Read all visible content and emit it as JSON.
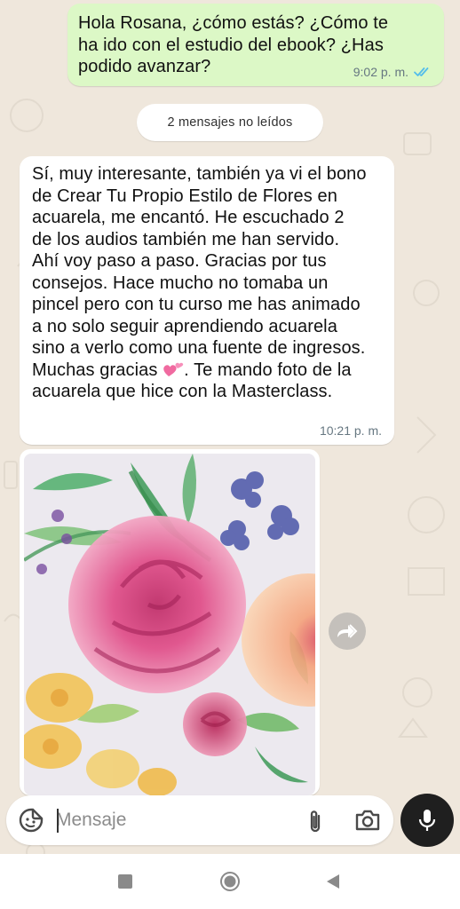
{
  "conversation": {
    "outgoing": {
      "text": "Hola Rosana, ¿cómo estás? ¿Cómo te\nha ido con el estudio del ebook? ¿Has\npodido avanzar?",
      "time": "9:02 p. m.",
      "status": "read"
    },
    "unread_divider": "2 mensajes no leídos",
    "incoming": {
      "text_before_emoji": "Sí, muy interesante, también ya vi el bono\nde Crear Tu Propio Estilo de  Flores en\nacuarela, me encantó. He escuchado 2\nde los audios también me han servido.\nAhí voy paso a paso. Gracias por tus\nconsejos. Hace mucho no tomaba un\npincel pero con tu curso me has animado\na no solo seguir aprendiendo acuarela\nsino a verlo como una fuente de ingresos.\nMuchas gracias ",
      "emoji": "two-hearts-icon",
      "text_after_emoji": ". Te mando foto de la\nacuarela que hice con la Masterclass.",
      "time": "10:21 p. m."
    },
    "image_message": {
      "description_icon": "watercolor-flowers-photo",
      "forward_icon": "forward-icon"
    }
  },
  "composer": {
    "placeholder": "Mensaje",
    "value": "",
    "emoji_icon": "sticker-icon",
    "attach_icon": "paperclip-icon",
    "camera_icon": "camera-icon",
    "mic_icon": "mic-icon"
  },
  "navbar": {
    "recents_icon": "square-icon",
    "home_icon": "circle-icon",
    "back_icon": "triangle-back-icon"
  },
  "colors": {
    "background": "#efe7dc",
    "outgoing_bubble": "#dcf8c6",
    "incoming_bubble": "#ffffff",
    "read_ticks": "#53bdeb",
    "mic_button": "#1f1f1f"
  }
}
